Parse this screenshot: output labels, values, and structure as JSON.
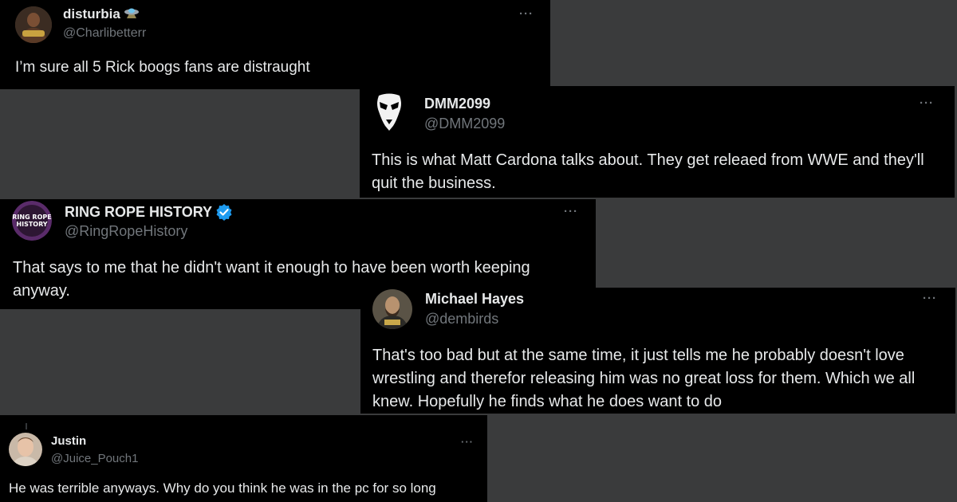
{
  "tweets": [
    {
      "display_name": "disturbia",
      "name_emoji": "ufo-icon",
      "handle": "@Charlibetterr",
      "text": "I’m sure all 5 Rick boogs fans are distraught",
      "more_label": "···"
    },
    {
      "display_name": "DMM2099",
      "handle": "@DMM2099",
      "text": "This is what Matt Cardona talks about. They get releaed from WWE and they'll quit the business.",
      "more_label": "···"
    },
    {
      "display_name": "RING ROPE HISTORY",
      "verified": true,
      "handle": "@RingRopeHistory",
      "text": "That says to me that he didn't want it enough to have been worth keeping anyway.",
      "avatar_text": [
        "RING ROPE",
        "HISTORY"
      ],
      "more_label": "···"
    },
    {
      "display_name": "Michael Hayes",
      "handle": "@dembirds",
      "text": "That's too bad but at the same time, it just tells me he probably doesn't love wrestling and therefor releasing him was no great loss for them. Which we all knew. Hopefully he finds what he does want to do",
      "more_label": "···"
    },
    {
      "display_name": "Justin",
      "handle": "@Juice_Pouch1",
      "text": "He was terrible anyways. Why do you think he was in the pc for so long",
      "more_label": "···"
    }
  ],
  "colors": {
    "background": "#3a3b3c",
    "card": "#000000",
    "text": "#e7e9ea",
    "secondary": "#71767b",
    "verified": "#1d9bf0"
  }
}
